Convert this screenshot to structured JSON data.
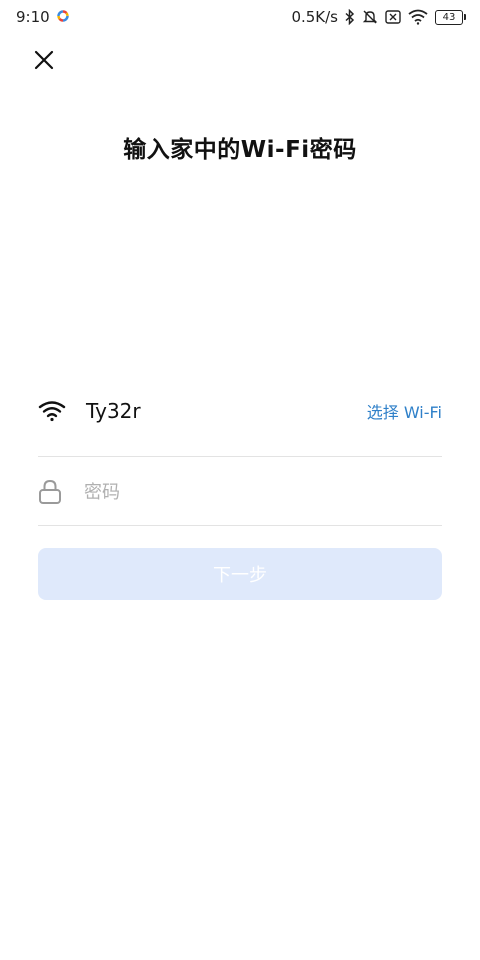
{
  "status_bar": {
    "time": "9:10",
    "net_speed": "0.5K/s",
    "battery": "43"
  },
  "title": "输入家中的Wi-Fi密码",
  "wifi": {
    "ssid": "Ty32r",
    "choose_label": "选择 Wi-Fi"
  },
  "password": {
    "placeholder": "密码",
    "value": ""
  },
  "next_button": {
    "label": "下一步",
    "enabled": false
  },
  "colors": {
    "accent": "#2f80c9",
    "button_disabled_bg": "#dfe9fb",
    "divider": "#e3e3e3"
  }
}
